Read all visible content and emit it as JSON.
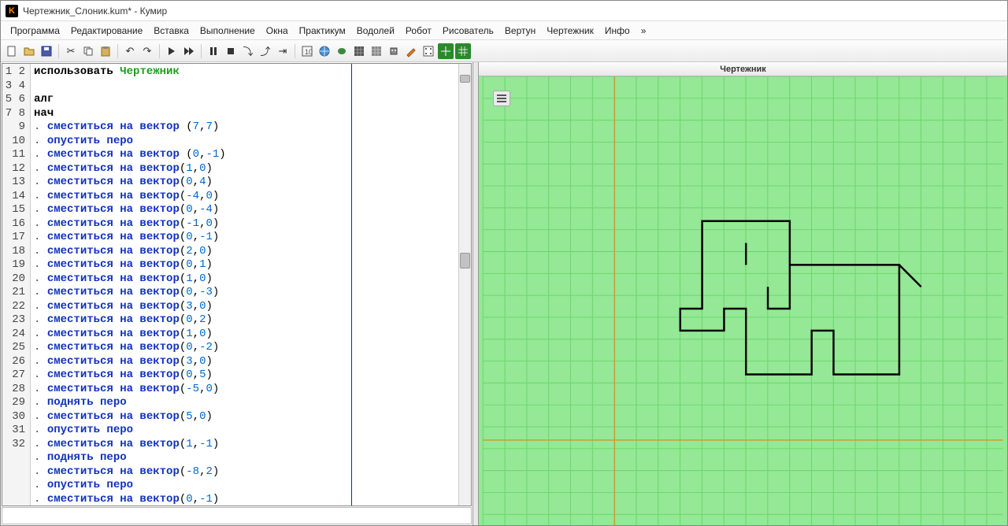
{
  "window": {
    "title": "Чертежник_Слоник.kum* - Кумир"
  },
  "menu": [
    "Программа",
    "Редактирование",
    "Вставка",
    "Выполнение",
    "Окна",
    "Практикум",
    "Водолей",
    "Робот",
    "Рисователь",
    "Вертун",
    "Чертежник",
    "Инфо",
    "»"
  ],
  "toolbar": [
    "new-file",
    "open-file",
    "save-file",
    "|",
    "cut",
    "copy",
    "paste",
    "|",
    "undo",
    "redo",
    "|",
    "run",
    "step",
    "|",
    "pause",
    "stop",
    "step-into",
    "step-over",
    "step-out",
    "|",
    "tool-grid",
    "tool-globe",
    "tool-t",
    "tool-grid2",
    "tool-grid3",
    "tool-robot",
    "tool-pencil",
    "tool-dots",
    "tool-green1",
    "tool-green2"
  ],
  "drawer": {
    "title": "Чертежник"
  },
  "code": {
    "lines": [
      {
        "n": 1,
        "t": "use",
        "use": "использовать",
        "mod": "Чертежник"
      },
      {
        "n": 2,
        "t": "blank"
      },
      {
        "n": 3,
        "t": "kw",
        "kw": "алг"
      },
      {
        "n": 4,
        "t": "kw",
        "kw": "нач"
      },
      {
        "n": 5,
        "t": "cmd",
        "cmd": "сместиться на вектор",
        "sp": " ",
        "args": "(7,7)"
      },
      {
        "n": 6,
        "t": "cmd",
        "cmd": "опустить перо"
      },
      {
        "n": 7,
        "t": "cmd",
        "cmd": "сместиться на вектор",
        "sp": " ",
        "args": "(0,-1)"
      },
      {
        "n": 8,
        "t": "cmd",
        "cmd": "сместиться на вектор",
        "args": "(1,0)"
      },
      {
        "n": 9,
        "t": "cmd",
        "cmd": "сместиться на вектор",
        "args": "(0,4)"
      },
      {
        "n": 10,
        "t": "cmd",
        "cmd": "сместиться на вектор",
        "args": "(-4,0)"
      },
      {
        "n": 11,
        "t": "cmd",
        "cmd": "сместиться на вектор",
        "args": "(0,-4)"
      },
      {
        "n": 12,
        "t": "cmd",
        "cmd": "сместиться на вектор",
        "args": "(-1,0)"
      },
      {
        "n": 13,
        "t": "cmd",
        "cmd": "сместиться на вектор",
        "args": "(0,-1)"
      },
      {
        "n": 14,
        "t": "cmd",
        "cmd": "сместиться на вектор",
        "args": "(2,0)"
      },
      {
        "n": 15,
        "t": "cmd",
        "cmd": "сместиться на вектор",
        "args": "(0,1)"
      },
      {
        "n": 16,
        "t": "cmd",
        "cmd": "сместиться на вектор",
        "args": "(1,0)"
      },
      {
        "n": 17,
        "t": "cmd",
        "cmd": "сместиться на вектор",
        "args": "(0,-3)"
      },
      {
        "n": 18,
        "t": "cmd",
        "cmd": "сместиться на вектор",
        "args": "(3,0)"
      },
      {
        "n": 19,
        "t": "cmd",
        "cmd": "сместиться на вектор",
        "args": "(0,2)"
      },
      {
        "n": 20,
        "t": "cmd",
        "cmd": "сместиться на вектор",
        "args": "(1,0)"
      },
      {
        "n": 21,
        "t": "cmd",
        "cmd": "сместиться на вектор",
        "args": "(0,-2)"
      },
      {
        "n": 22,
        "t": "cmd",
        "cmd": "сместиться на вектор",
        "args": "(3,0)"
      },
      {
        "n": 23,
        "t": "cmd",
        "cmd": "сместиться на вектор",
        "args": "(0,5)"
      },
      {
        "n": 24,
        "t": "cmd",
        "cmd": "сместиться на вектор",
        "args": "(-5,0)"
      },
      {
        "n": 25,
        "t": "cmd",
        "cmd": "поднять перо"
      },
      {
        "n": 26,
        "t": "cmd",
        "cmd": "сместиться на вектор",
        "args": "(5,0)"
      },
      {
        "n": 27,
        "t": "cmd",
        "cmd": "опустить перо"
      },
      {
        "n": 28,
        "t": "cmd",
        "cmd": "сместиться на вектор",
        "args": "(1,-1)"
      },
      {
        "n": 29,
        "t": "cmd",
        "cmd": "поднять перо"
      },
      {
        "n": 30,
        "t": "cmd",
        "cmd": "сместиться на вектор",
        "args": "(-8,2)"
      },
      {
        "n": 31,
        "t": "cmd",
        "cmd": "опустить перо"
      },
      {
        "n": 32,
        "t": "cmd",
        "cmd": "сместиться на вектор",
        "args": "(0,-1)"
      }
    ]
  }
}
